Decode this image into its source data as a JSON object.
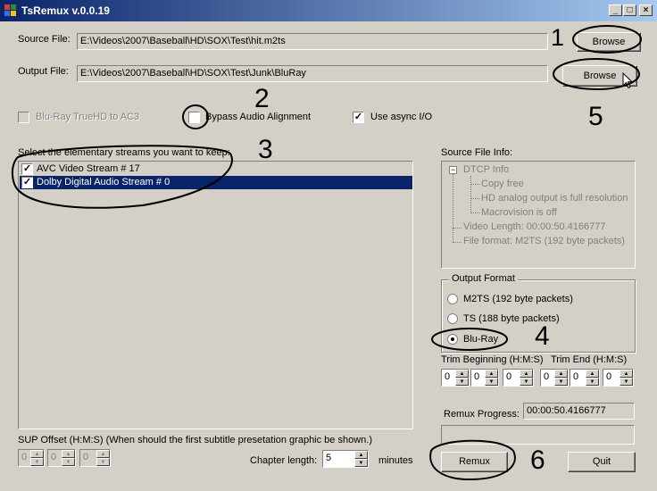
{
  "window": {
    "title": "TsRemux v.0.0.19"
  },
  "source": {
    "label": "Source File:",
    "value": "E:\\Videos\\2007\\Baseball\\HD\\SOX\\Test\\hit.m2ts",
    "browse": "Browse"
  },
  "output": {
    "label": "Output File:",
    "value": "E:\\Videos\\2007\\Baseball\\HD\\SOX\\Test\\Junk\\BluRay",
    "browse": "Browse"
  },
  "options": {
    "truehd": {
      "label": "Blu-Ray TrueHD to AC3",
      "checked": false,
      "enabled": false
    },
    "bypass": {
      "label": "Bypass Audio Alignment",
      "checked": false
    },
    "async": {
      "label": "Use async I/O",
      "checked": true
    }
  },
  "streams": {
    "label": "Select the elementary streams you want to keep:",
    "items": [
      {
        "label": "AVC Video Stream # 17",
        "checked": true,
        "selected": false
      },
      {
        "label": "Dolby Digital Audio Stream # 0",
        "checked": true,
        "selected": true
      }
    ]
  },
  "source_info": {
    "label": "Source File Info:",
    "root": "DTCP Info",
    "root_toggle": "−",
    "children": [
      "Copy free",
      "HD analog output is full resolution",
      "Macrovision is off"
    ],
    "video_length": "Video Length: 00:00:50.4166777",
    "file_format": "File format: M2TS (192 byte packets)"
  },
  "output_format": {
    "legend": "Output Format",
    "options": [
      {
        "label": "M2TS (192 byte packets)",
        "selected": false
      },
      {
        "label": "TS (188 byte packets)",
        "selected": false
      },
      {
        "label": "Blu-Ray",
        "selected": true
      }
    ]
  },
  "trim": {
    "begin_label": "Trim Beginning (H:M:S)",
    "end_label": "Trim End (H:M:S)",
    "begin": [
      "0",
      "0",
      "0"
    ],
    "end": [
      "0",
      "0",
      "0"
    ]
  },
  "remux_progress": {
    "label": "Remux Progress:",
    "value": "00:00:50.4166777",
    "fraction": 0
  },
  "sup": {
    "label": "SUP Offset (H:M:S) (When should the first subtitle presetation graphic be shown.)",
    "values": [
      "0",
      "0",
      "0"
    ]
  },
  "chapter": {
    "label": "Chapter length:",
    "value": "5",
    "unit": "minutes"
  },
  "buttons": {
    "remux": "Remux",
    "quit": "Quit"
  },
  "annotations": [
    "1",
    "2",
    "3",
    "4",
    "5",
    "6"
  ],
  "icons": {
    "app": "tsremux-app-icon",
    "cursor": "mouse-cursor-icon"
  },
  "colors": {
    "title_start": "#0a246a",
    "title_end": "#a6caf0",
    "selection": "#0a246a",
    "face": "#d4d0c8"
  }
}
